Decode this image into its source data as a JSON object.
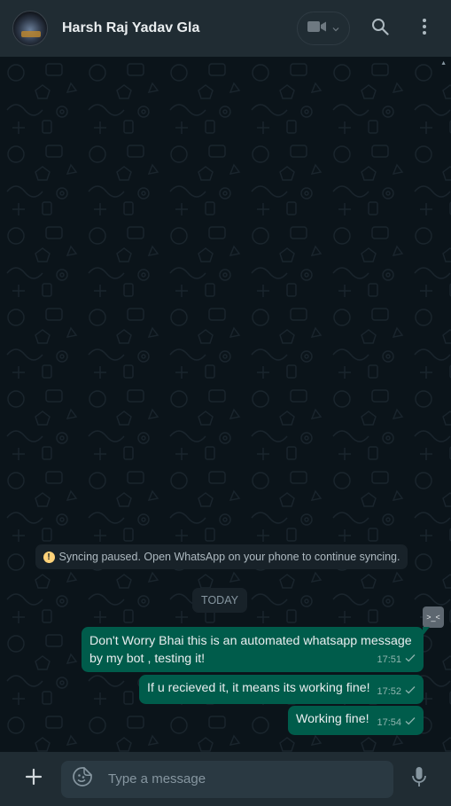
{
  "header": {
    "contact_name": "Harsh Raj Yadav Gla",
    "icons": [
      "avatar",
      "video-call-icon",
      "chevron-down-icon",
      "search-icon",
      "menu-icon"
    ]
  },
  "chat": {
    "sync_notice": "Syncing paused. Open WhatsApp on your phone to continue syncing.",
    "date_divider": "TODAY",
    "emoji_chip": ">_<",
    "messages": [
      {
        "text": "Don't Worry Bhai this is an automated whatsapp message by my bot , testing it!",
        "time": "17:51",
        "status": "sent"
      },
      {
        "text": "If u recieved it, it means its working fine!",
        "time": "17:52",
        "status": "sent"
      },
      {
        "text": "Working fine!",
        "time": "17:54",
        "status": "sent"
      }
    ]
  },
  "composer": {
    "placeholder": "Type a message",
    "icons": [
      "plus-icon",
      "sticker-icon",
      "mic-icon"
    ]
  },
  "colors": {
    "header_bg": "#202c33",
    "chat_bg": "#0b141a",
    "outgoing_bubble": "#005c4b",
    "input_bg": "#2a3942",
    "muted_text": "#8696a0"
  }
}
